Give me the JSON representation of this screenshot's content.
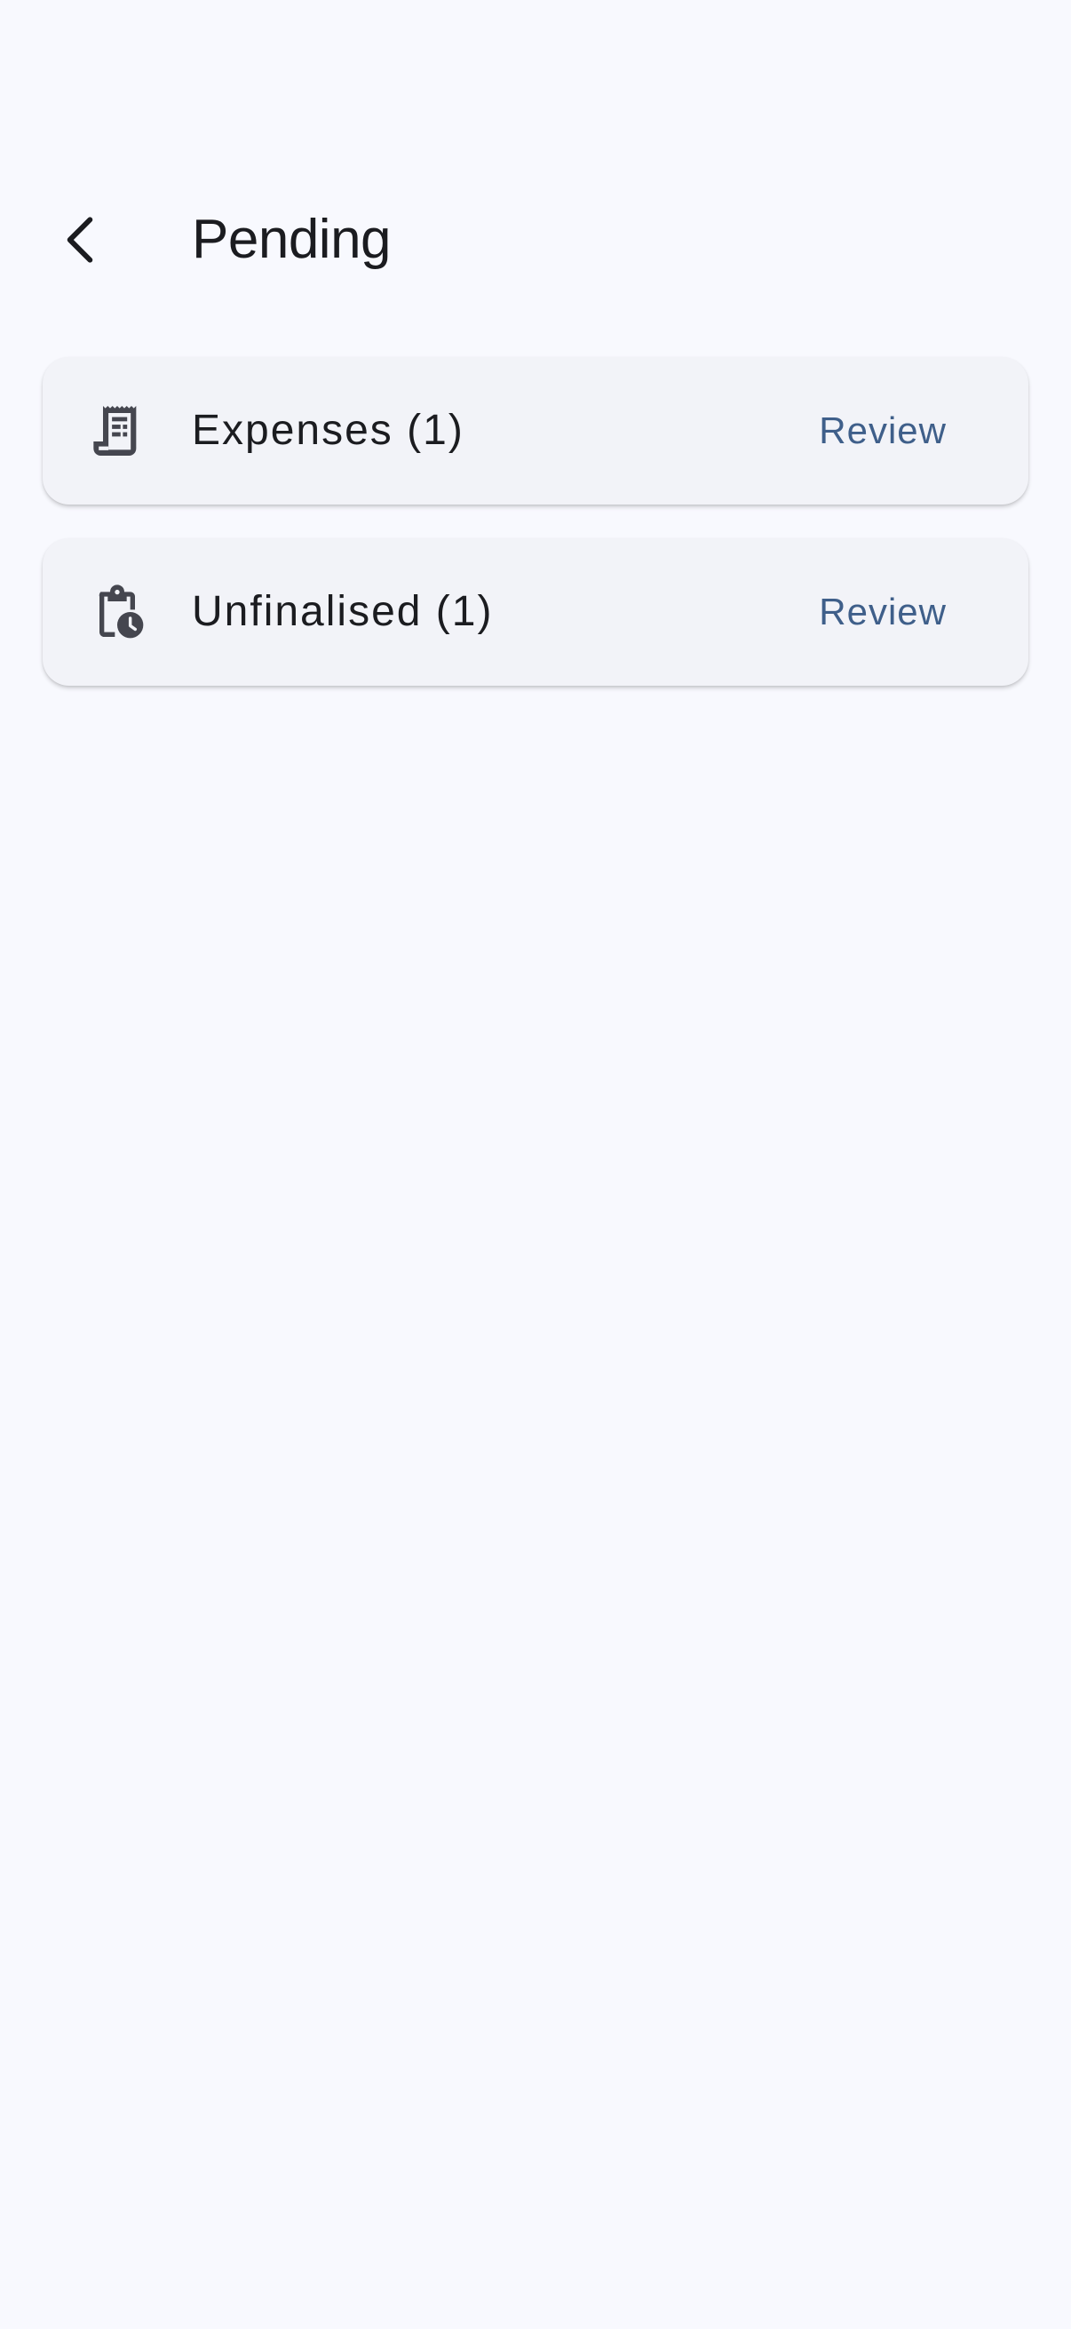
{
  "header": {
    "back_icon": "chevron-left-icon",
    "title": "Pending"
  },
  "items": [
    {
      "icon": "receipt-icon",
      "label": "Expenses (1)",
      "action_label": "Review"
    },
    {
      "icon": "clipboard-clock-icon",
      "label": "Unfinalised (1)",
      "action_label": "Review"
    }
  ],
  "colors": {
    "background": "#f8f9fe",
    "card": "#f2f3f8",
    "text": "#1b1c20",
    "accent": "#3f5f8a",
    "icon": "#45464f"
  }
}
